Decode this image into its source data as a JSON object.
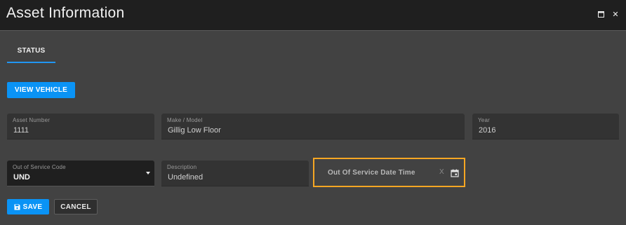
{
  "window": {
    "title": "Asset Information",
    "maximize_icon": "window-maximize-icon",
    "close_icon": "close-icon",
    "close_glyph": "✕"
  },
  "tabs": [
    {
      "label": "STATUS",
      "active": true
    }
  ],
  "actions": {
    "view_vehicle_label": "VIEW VEHICLE",
    "save_label": "SAVE",
    "save_icon": "floppy-disk-icon",
    "cancel_label": "CANCEL"
  },
  "fields": {
    "asset_number": {
      "label": "Asset Number",
      "value": "1111"
    },
    "make_model": {
      "label": "Make / Model",
      "value": "Gillig Low Floor"
    },
    "year": {
      "label": "Year",
      "value": "2016"
    },
    "out_of_service_code": {
      "label": "Out of Service Code",
      "value": "UND"
    },
    "description": {
      "label": "Description",
      "value": "Undefined"
    },
    "out_of_service_datetime": {
      "placeholder": "Out Of Service Date Time",
      "clear_label": "X",
      "calendar_icon": "calendar-icon"
    }
  },
  "colors": {
    "background": "#424242",
    "titlebar": "#1f1f1f",
    "accent": "#0a93f5",
    "focus_outline": "#f5a623"
  }
}
